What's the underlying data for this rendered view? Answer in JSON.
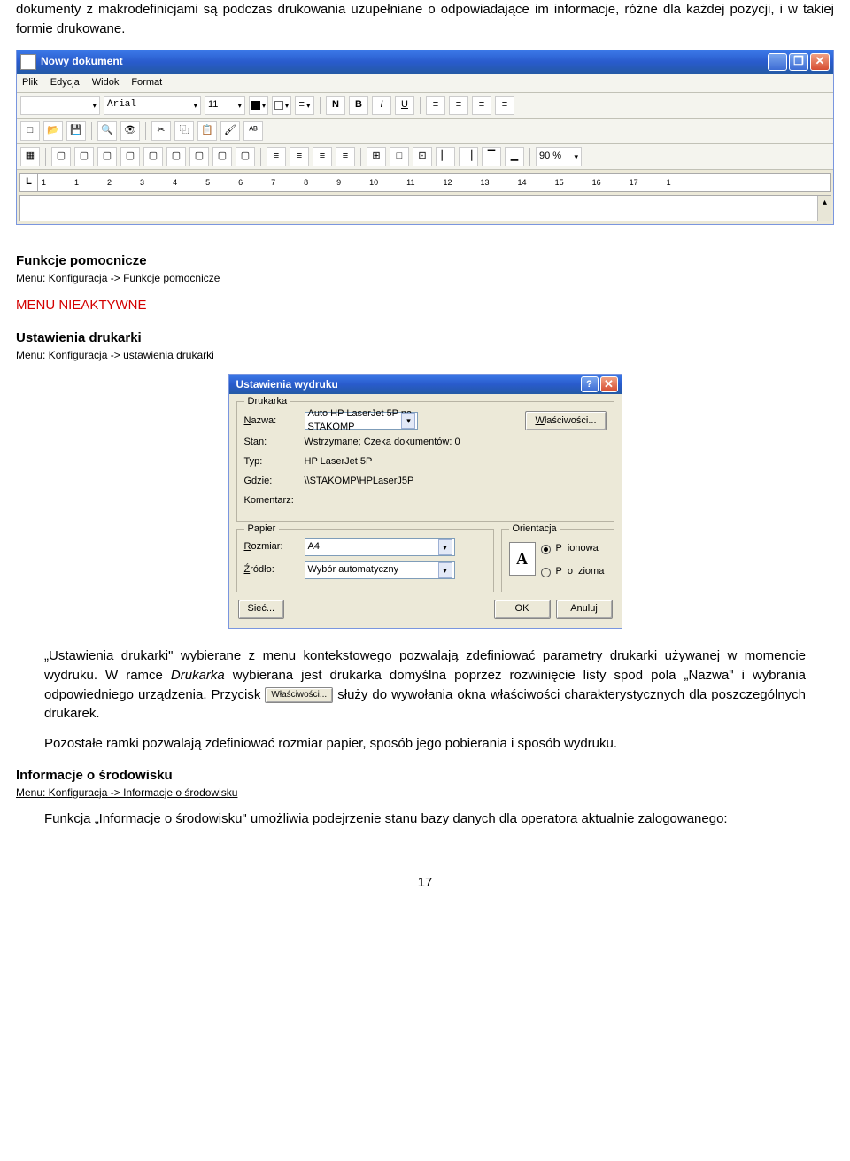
{
  "intro_para": "dokumenty z makrodefinicjami są podczas drukowania uzupełniane o odpowiadające im informacje, różne dla każdej pozycji, i w takiej formie drukowane.",
  "win1": {
    "title": "Nowy dokument",
    "menubar": [
      "Plik",
      "Edycja",
      "Widok",
      "Format"
    ],
    "font_name": "Arial",
    "font_size": "11",
    "zoom": "90 %",
    "ruler_L": "L",
    "ruler_nums": [
      "1",
      "1",
      "2",
      "3",
      "4",
      "5",
      "6",
      "7",
      "8",
      "9",
      "10",
      "11",
      "12",
      "13",
      "14",
      "15",
      "16",
      "17",
      "1"
    ]
  },
  "sec1": {
    "heading": "Funkcje pomocnicze",
    "menu": "Menu: Konfiguracja -> Funkcje pomocnicze",
    "inactive": "MENU NIEAKTYWNE"
  },
  "sec2": {
    "heading": "Ustawienia drukarki",
    "menu": "Menu: Konfiguracja -> ustawienia drukarki"
  },
  "dlg": {
    "title": "Ustawienia wydruku",
    "grp_printer": "Drukarka",
    "name_lab": "Nazwa:",
    "name_val": "Auto HP LaserJet 5P na STAKOMP",
    "props": "Właściwości...",
    "state_lab": "Stan:",
    "state_val": "Wstrzymane; Czeka dokumentów: 0",
    "type_lab": "Typ:",
    "type_val": "HP LaserJet 5P",
    "where_lab": "Gdzie:",
    "where_val": "\\\\STAKOMP\\HPLaserJ5P",
    "comment_lab": "Komentarz:",
    "grp_paper": "Papier",
    "size_lab": "Rozmiar:",
    "size_val": "A4",
    "src_lab": "Źródło:",
    "src_val": "Wybór automatyczny",
    "grp_orient": "Orientacja",
    "A": "A",
    "portrait": "Pionowa",
    "landscape": "Pozioma",
    "net": "Sieć...",
    "ok": "OK",
    "cancel": "Anuluj"
  },
  "para2_a": "„Ustawienia drukarki\" wybierane z menu kontekstowego pozwalają zdefiniować parametry drukarki używanej w momencie wydruku. W ramce ",
  "para2_em": "Drukarka",
  "para2_b": " wybierana jest drukarka domyślna poprzez rozwinięcie listy spod pola „Nazwa\" i wybrania odpowiedniego urządzenia. Przycisk ",
  "para2_c": " służy do wywołania okna właściwości charakterystycznych dla poszczególnych drukarek.",
  "para3": "Pozostałe ramki pozwalają zdefiniować rozmiar papier, sposób jego pobierania i sposób wydruku.",
  "inline_btn": "Właściwości...",
  "sec3": {
    "heading": "Informacje o środowisku",
    "menu": "Menu: Konfiguracja -> Informacje o środowisku"
  },
  "para4": "Funkcja „Informacje o środowisku\" umożliwia podejrzenie stanu bazy danych dla operatora aktualnie zalogowanego:",
  "page_num": "17"
}
